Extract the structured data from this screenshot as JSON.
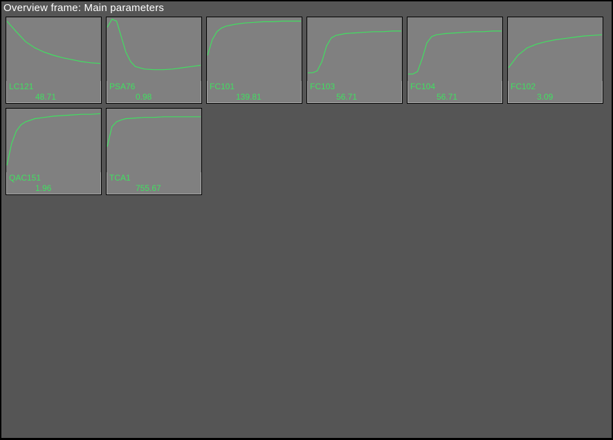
{
  "title": "Overview frame: Main parameters",
  "colors": {
    "panel_bg": "#555555",
    "tile_bg": "#808080",
    "trend_line": "#40e060",
    "text_green": "#40e060",
    "title_text": "#ffffff"
  },
  "tiles": [
    {
      "label": "LC121",
      "value": "48.71",
      "chart_data": {
        "type": "line",
        "x": [
          0,
          10,
          20,
          30,
          40,
          50,
          60,
          70,
          80,
          90,
          100
        ],
        "y": [
          95,
          78,
          62,
          52,
          45,
          40,
          36,
          33,
          30,
          28,
          27
        ],
        "ylim": [
          0,
          100
        ]
      }
    },
    {
      "label": "PSA76",
      "value": "0.98",
      "chart_data": {
        "type": "line",
        "x": [
          0,
          5,
          10,
          15,
          20,
          25,
          30,
          40,
          50,
          60,
          70,
          80,
          90,
          100
        ],
        "y": [
          85,
          98,
          95,
          70,
          45,
          30,
          22,
          18,
          17,
          17,
          18,
          20,
          22,
          24
        ],
        "ylim": [
          0,
          100
        ]
      }
    },
    {
      "label": "FC101",
      "value": "139.81",
      "chart_data": {
        "type": "line",
        "x": [
          0,
          5,
          10,
          15,
          20,
          30,
          40,
          50,
          60,
          70,
          80,
          90,
          100
        ],
        "y": [
          40,
          65,
          78,
          84,
          87,
          90,
          92,
          93,
          94,
          94,
          95,
          95,
          95
        ],
        "ylim": [
          0,
          100
        ]
      }
    },
    {
      "label": "FC103",
      "value": "56.71",
      "chart_data": {
        "type": "line",
        "x": [
          0,
          5,
          10,
          15,
          20,
          25,
          30,
          40,
          50,
          60,
          70,
          80,
          90,
          100
        ],
        "y": [
          12,
          12,
          15,
          30,
          55,
          68,
          72,
          75,
          76,
          77,
          78,
          78,
          79,
          79
        ],
        "ylim": [
          0,
          100
        ]
      }
    },
    {
      "label": "FC104",
      "value": "56.71",
      "chart_data": {
        "type": "line",
        "x": [
          0,
          5,
          10,
          15,
          20,
          25,
          30,
          40,
          50,
          60,
          70,
          80,
          90,
          100
        ],
        "y": [
          10,
          10,
          14,
          35,
          60,
          70,
          73,
          75,
          76,
          77,
          78,
          78,
          79,
          79
        ],
        "ylim": [
          0,
          100
        ]
      }
    },
    {
      "label": "FC102",
      "value": "3.09",
      "chart_data": {
        "type": "line",
        "x": [
          0,
          10,
          20,
          30,
          40,
          50,
          60,
          70,
          80,
          90,
          100
        ],
        "y": [
          20,
          40,
          52,
          58,
          62,
          65,
          67,
          69,
          71,
          72,
          73
        ],
        "ylim": [
          0,
          100
        ]
      }
    },
    {
      "label": "QAC151",
      "value": "1.96",
      "chart_data": {
        "type": "line",
        "x": [
          0,
          5,
          10,
          15,
          20,
          30,
          40,
          50,
          60,
          70,
          80,
          90,
          100
        ],
        "y": [
          10,
          45,
          65,
          75,
          80,
          85,
          87,
          89,
          90,
          91,
          92,
          92,
          93
        ],
        "ylim": [
          0,
          100
        ]
      }
    },
    {
      "label": "TCA1",
      "value": "755.67",
      "chart_data": {
        "type": "line",
        "x": [
          0,
          5,
          10,
          15,
          20,
          30,
          40,
          50,
          60,
          70,
          80,
          90,
          100
        ],
        "y": [
          40,
          72,
          80,
          83,
          85,
          86,
          87,
          87,
          88,
          88,
          88,
          88,
          88
        ],
        "ylim": [
          0,
          100
        ]
      }
    }
  ]
}
